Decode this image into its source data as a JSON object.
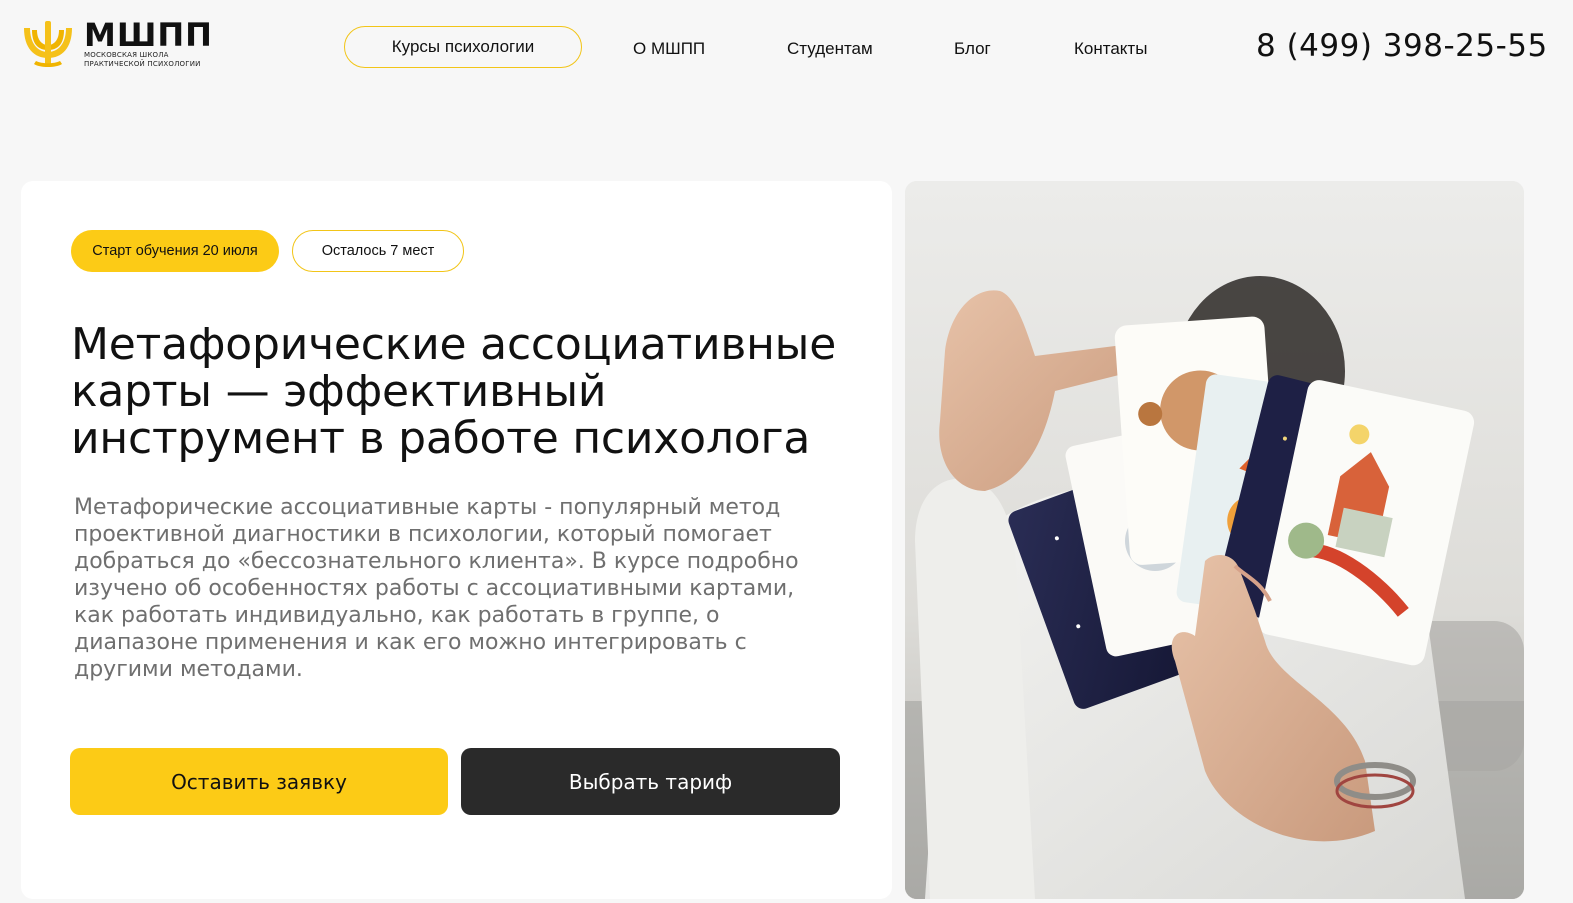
{
  "header": {
    "logo": {
      "title": "МШПП",
      "subtitle_line1": "Московская школа",
      "subtitle_line2": "практической психологии"
    },
    "nav": {
      "courses": "Курсы психологии",
      "about": "О МШПП",
      "students": "Студентам",
      "blog": "Блог",
      "contacts": "Контакты"
    },
    "phone": "8 (499) 398-25-55"
  },
  "hero": {
    "badges": {
      "start": "Старт обучения 20 июля",
      "seats": "Осталось 7 мест"
    },
    "title": "Метафорические ассоциативные карты — эффективный инструмент в работе психолога",
    "description": "Метафорические ассоциативные карты - популярный метод проективной диагностики в психологии, который помогает добраться до «бессознательного клиента». В курсе подробно изучено об особенностях работы с ассоциативными картами, как работать индивидуально, как работать в группе, о диапазоне применения и как его можно интегрировать с другими методами.",
    "buttons": {
      "apply": "Оставить заявку",
      "tariff": "Выбрать тариф"
    }
  },
  "colors": {
    "accent": "#fccb16",
    "dark_button": "#2a2a2a",
    "page_background": "#f7f7f7",
    "muted_text": "#6f6f6f"
  }
}
